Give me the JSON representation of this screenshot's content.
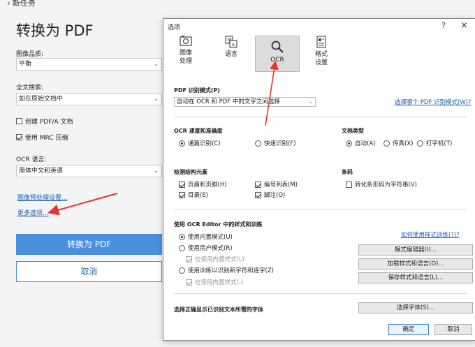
{
  "left_panel": {
    "back_label": "新任务",
    "title": "转换为 PDF",
    "image_quality_label": "图像品质:",
    "image_quality_value": "平衡",
    "fulltext_label": "全文搜索:",
    "fulltext_value": "如在原始文档中",
    "create_pdfa_label": "创建 PDF/A 文档",
    "create_pdfa_checked": false,
    "mrc_label": "使用 MRC 压缩",
    "mrc_checked": true,
    "ocr_lang_label": "OCR 语言:",
    "ocr_lang_value": "简体中文和英语",
    "preprocess_link": "图像预处理设置...",
    "more_options_link": "更多选项...",
    "convert_button": "转换为 PDF",
    "cancel_button": "取消"
  },
  "dialog": {
    "title": "选项",
    "help_label": "?",
    "close_label": "×",
    "tabs": [
      {
        "label": "图像\n处理",
        "icon": "image-processing-icon",
        "active": false
      },
      {
        "label": "语言",
        "icon": "language-icon",
        "active": false
      },
      {
        "label": "OCR",
        "icon": "ocr-search-icon",
        "active": true
      },
      {
        "label": "格式\n设置",
        "icon": "format-settings-icon",
        "active": false
      }
    ],
    "pdf_mode": {
      "label": "PDF 识别模式(P)",
      "value": "自动在 OCR 和 PDF 中的文字之间选择",
      "link": "选择哪个 PDF 识别模式(W)?"
    },
    "speed": {
      "label": "OCR 速度和准确度",
      "options": [
        "通篇识别(C)",
        "快速识别(F)"
      ],
      "selected": 0
    },
    "doc_type": {
      "label": "文档类型",
      "options": [
        "自动(A)",
        "传真(X)",
        "打字机(T)"
      ],
      "selected": 0
    },
    "structure": {
      "label": "检测结构元素",
      "items": [
        {
          "label": "页眉和页脚(H)",
          "checked": true
        },
        {
          "label": "编号列表(M)",
          "checked": true
        },
        {
          "label": "目录(E)",
          "checked": true
        },
        {
          "label": "脚注(O)",
          "checked": true
        }
      ]
    },
    "barcode": {
      "label": "条码",
      "item": "转化条形码为字符串(V)",
      "checked": false
    },
    "patterns": {
      "label": "使用 OCR Editor 中的样式和训练",
      "link": "如何使用样式训练(?)?",
      "options": [
        "使用内置模式(U)",
        "使用用户模式(R)",
        "使用训练以识别新字符和连字(Z)"
      ],
      "selected": 0,
      "sub_also_builtin_1": "也使用内置样式(L)",
      "sub_also_builtin_2": "也使用内置样式(-)",
      "buttons": [
        "模式编辑器(I)...",
        "加载样式和语言(O)...",
        "保存样式和语言(L)..."
      ]
    },
    "fonts": {
      "label": "选择正确显示已识别文本所需的字体",
      "button": "选择字体(S)..."
    },
    "ok_button": "确定",
    "cancel_button": "取消"
  },
  "colors": {
    "accent": "#4a8fdb",
    "link": "#1b5fb5",
    "annotation_arrow": "#e8322b"
  }
}
